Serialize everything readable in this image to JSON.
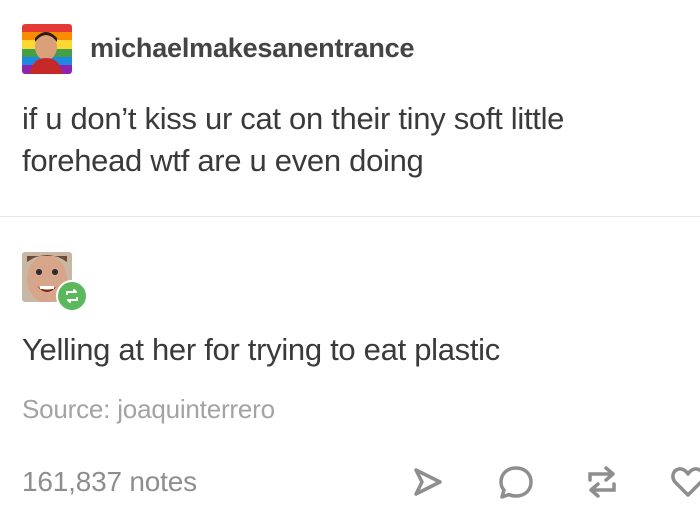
{
  "post": {
    "username": "michaelmakesanentrance",
    "text": "if u don’t kiss ur cat on their tiny soft little forehead wtf are u even doing"
  },
  "reblog": {
    "text": "Yelling at her for trying to eat plastic",
    "source": "Source: joaquinterrero"
  },
  "footer": {
    "notes": "161,837 notes",
    "icons": [
      "share-icon",
      "reply-icon",
      "reblog-icon",
      "like-icon"
    ]
  },
  "colors": {
    "text": "#3a3a3a",
    "muted": "#a3a3a3",
    "reblog_green": "#5bb85d"
  }
}
